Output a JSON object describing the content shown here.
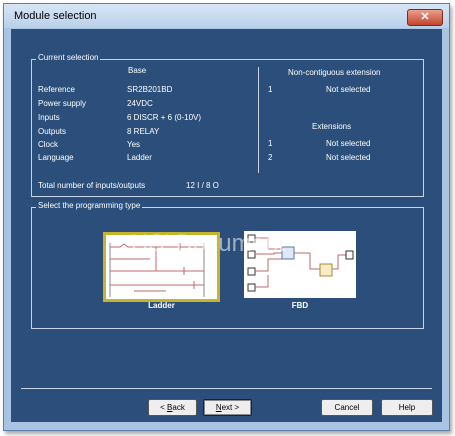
{
  "window": {
    "title": "Module selection",
    "close_label": "✕"
  },
  "current_selection": {
    "group_title": "Current selection",
    "base_header": "Base",
    "rows": [
      {
        "label": "Reference",
        "value": "SR2B201BD"
      },
      {
        "label": "Power supply",
        "value": "24VDC"
      },
      {
        "label": "Inputs",
        "value": "6 DISCR + 6 (0-10V)"
      },
      {
        "label": "Outputs",
        "value": "8 RELAY"
      },
      {
        "label": "Clock",
        "value": "Yes"
      },
      {
        "label": "Language",
        "value": "Ladder"
      }
    ],
    "total_label": "Total number of inputs/outputs",
    "total_value": "12 I / 8 O"
  },
  "non_contiguous": {
    "header": "Non-contiguous extension",
    "items": [
      {
        "num": "1",
        "status": "Not selected"
      }
    ]
  },
  "extensions": {
    "header": "Extensions",
    "items": [
      {
        "num": "1",
        "status": "Not selected"
      },
      {
        "num": "2",
        "status": "Not selected"
      }
    ]
  },
  "programming": {
    "group_title": "Select the programming type",
    "selected": "Ladder",
    "options": [
      {
        "label": "Ladder"
      },
      {
        "label": "FBD"
      }
    ]
  },
  "watermark": "HS' Document",
  "buttons": {
    "back": {
      "accel": "B",
      "rest": "ack",
      "prefix": "< "
    },
    "next": {
      "accel": "N",
      "rest": "ext",
      "suffix": " >"
    },
    "cancel": "Cancel",
    "help": "Help"
  }
}
